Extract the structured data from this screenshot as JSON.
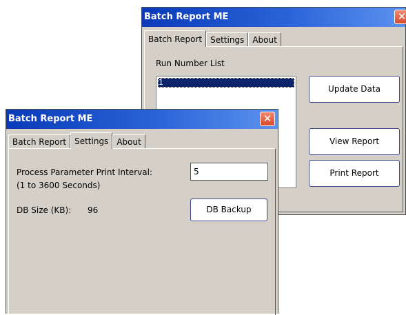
{
  "back_window": {
    "title": "Batch Report ME",
    "close": "✕",
    "tabs": [
      {
        "label": "Batch Report",
        "active": true
      },
      {
        "label": "Settings",
        "active": false
      },
      {
        "label": "About",
        "active": false
      }
    ],
    "run_number_label": "Run Number List",
    "run_list": [
      "1"
    ],
    "buttons": {
      "update": "Update Data",
      "view": "View Report",
      "print": "Print Report"
    }
  },
  "front_window": {
    "title": "Batch Report ME",
    "close": "✕",
    "tabs": [
      {
        "label": "Batch Report",
        "active": false
      },
      {
        "label": "Settings",
        "active": true
      },
      {
        "label": "About",
        "active": false
      }
    ],
    "interval_label": "Process Parameter Print Interval:",
    "interval_range": "(1 to 3600 Seconds)",
    "interval_value": "5",
    "db_size_label": "DB Size (KB):",
    "db_size_value": "96",
    "db_backup_button": "DB Backup"
  }
}
